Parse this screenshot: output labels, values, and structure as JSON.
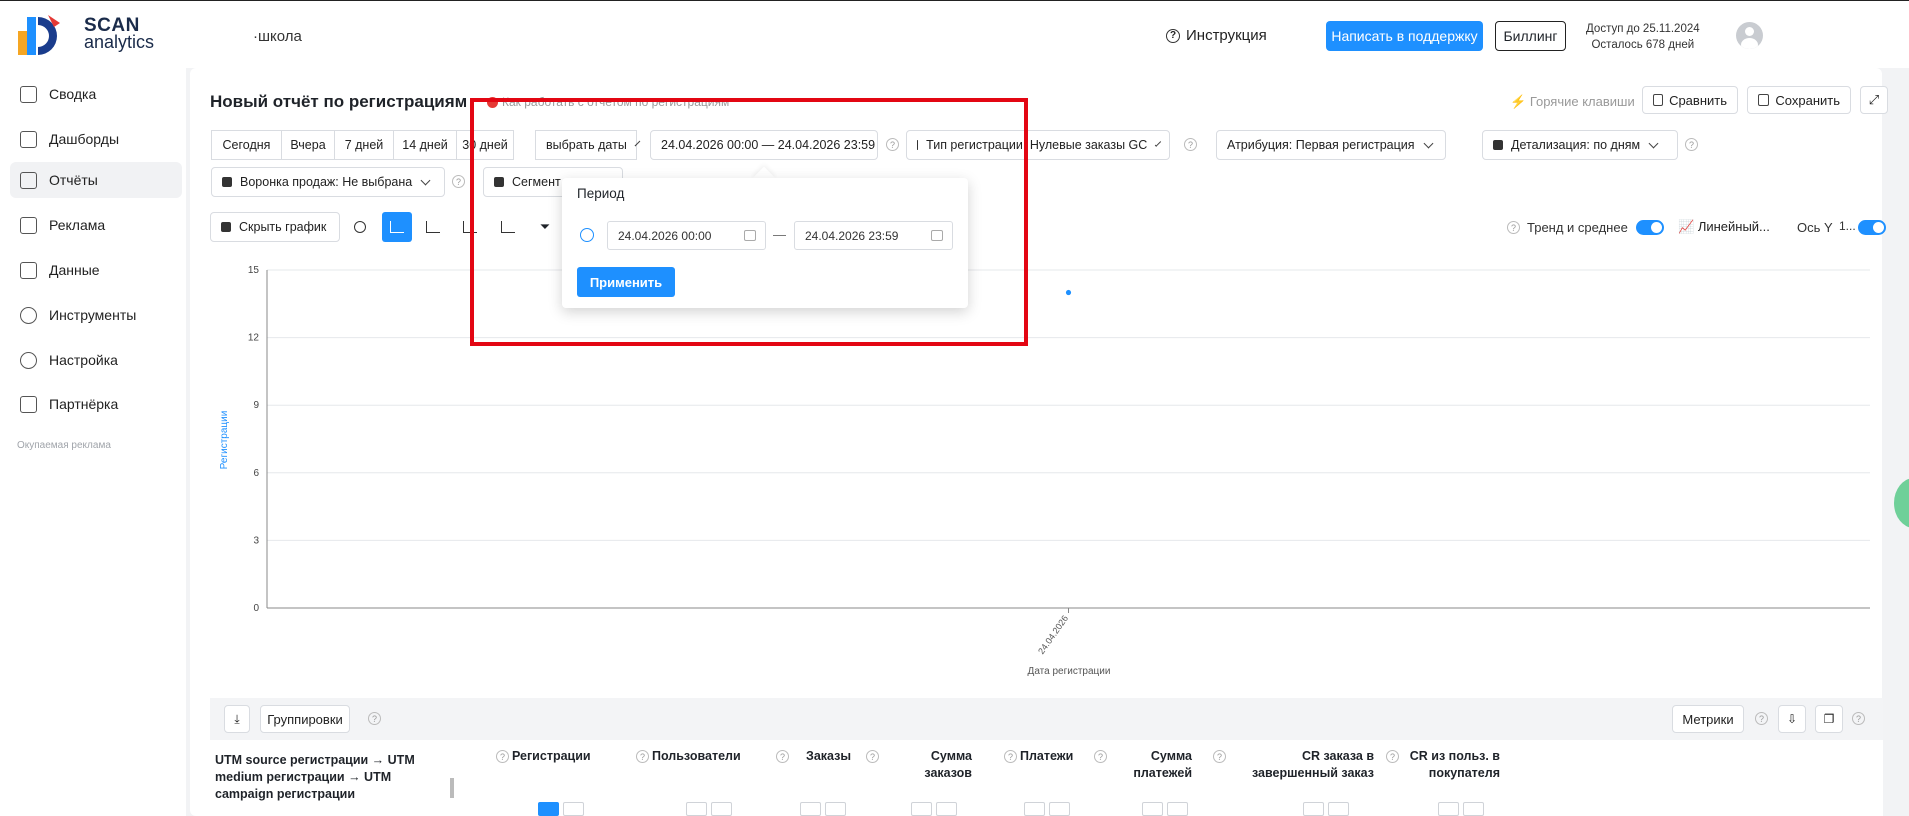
{
  "header": {
    "logo_line1": "SCAN",
    "logo_line2": "analytics",
    "workspace": "·школа",
    "help_label": "Инструкция",
    "support_button": "Написать в поддержку",
    "billing_button": "Биллинг",
    "access_until": "Доступ до 25.11.2024",
    "days_left": "Осталось 678 дней"
  },
  "sidebar": {
    "items": [
      {
        "label": "Сводка"
      },
      {
        "label": "Дашборды"
      },
      {
        "label": "Отчёты",
        "active": true
      },
      {
        "label": "Реклама"
      },
      {
        "label": "Данные"
      },
      {
        "label": "Инструменты"
      },
      {
        "label": "Настройка"
      },
      {
        "label": "Партнёрка"
      }
    ],
    "footer": "Окупаемая реклама"
  },
  "report": {
    "title": "Новый отчёт по регистрациям",
    "howto": "Как работать с отчетом по регистрациям",
    "hotkeys": "Горячие клавиши",
    "compare": "Сравнить",
    "save": "Сохранить"
  },
  "filters": {
    "today": "Сегодня",
    "yesterday": "Вчера",
    "d7": "7 дней",
    "d14": "14 дней",
    "d30": "30 дней",
    "pick": "выбрать даты",
    "range": "24.04.2026 00:00  —  24.04.2026 23:59",
    "reg_type": "Тип регистрации: Нулевые заказы GC",
    "attribution": "Атрибуция: Первая регистрация",
    "detail": "Детализация:  по дням",
    "funnel": "Воронка продаж: Не выбрана",
    "segment": "Сегмент"
  },
  "chart_toolbar": {
    "hide_chart": "Скрыть график",
    "trend": "Тренд и среднее",
    "linear": "Линейный...",
    "axis_y": "Ось Y",
    "axis_y_suffix": "1..."
  },
  "chart_data": {
    "type": "scatter",
    "x": [
      "24.04.2026"
    ],
    "series": [
      {
        "values": [
          14
        ]
      }
    ],
    "xlabel": "Дата регистрации",
    "ylabel": "Регистрации",
    "ylim": [
      0,
      15
    ],
    "yticks": [
      0,
      3,
      6,
      9,
      12,
      15
    ],
    "grid": true,
    "color": "#1e90ff"
  },
  "table": {
    "groupings": "Группировки",
    "metrics": "Метрики",
    "group_header": "UTM source регистрации → UTM medium регистрации → UTM campaign регистрации",
    "columns": [
      {
        "title": "Регистрации"
      },
      {
        "title": "Пользователи"
      },
      {
        "title": "Заказы"
      },
      {
        "title": "Сумма заказов"
      },
      {
        "title": "Платежи"
      },
      {
        "title": "Сумма платежей"
      },
      {
        "title": "CR заказа в завершенный заказ"
      },
      {
        "title": "CR из польз. в покупателя"
      }
    ]
  },
  "popup": {
    "title": "Период",
    "from": "24.04.2026 00:00",
    "to": "24.04.2026 23:59",
    "dash": "—",
    "apply": "Применить"
  }
}
